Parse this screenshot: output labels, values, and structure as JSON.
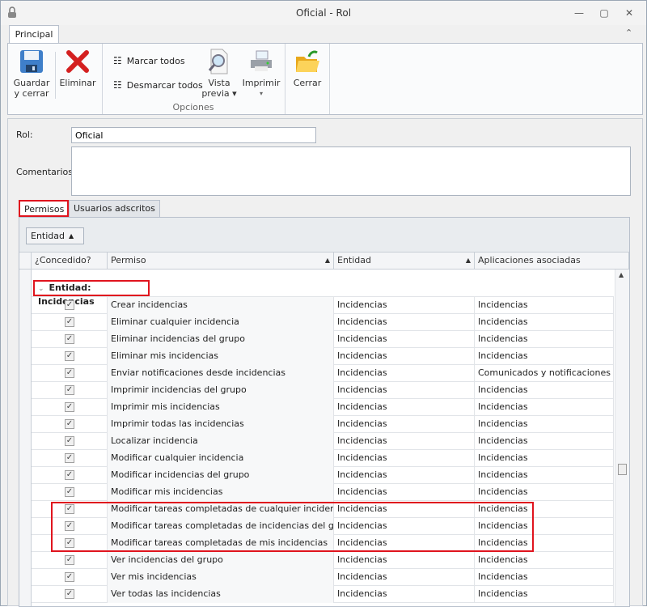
{
  "window": {
    "title": "Oficial - Rol",
    "minimize": "—",
    "maximize": "▢",
    "close": "✕"
  },
  "ribbon": {
    "tab": "Principal",
    "collapse": "⌃",
    "save_l1": "Guardar",
    "save_l2": "y cerrar",
    "delete": "Eliminar",
    "mark_all": "Marcar todos",
    "unmark_all": "Desmarcar todos",
    "preview_l1": "Vista",
    "preview_l2": "previa ▾",
    "print": "Imprimir",
    "print_arrow": "▾",
    "close": "Cerrar",
    "group_options": "Opciones"
  },
  "form": {
    "rol_label": "Rol:",
    "rol_value": "Oficial",
    "comments_label": "Comentarios:",
    "comments_value": ""
  },
  "tabs": [
    "Permisos",
    "Usuarios adscritos"
  ],
  "grid": {
    "group_button": "Entidad",
    "group_arrow": "▲",
    "columns": [
      "¿Concedido?",
      "Permiso",
      "Entidad",
      "Aplicaciones  asociadas"
    ],
    "sort_arrow": "▲",
    "group_row": "Entidad: Incidencias",
    "rows": [
      {
        "checked": true,
        "permiso": "Crear incidencias",
        "entidad": "Incidencias",
        "apps": "Incidencias"
      },
      {
        "checked": true,
        "permiso": "Eliminar cualquier incidencia",
        "entidad": "Incidencias",
        "apps": "Incidencias"
      },
      {
        "checked": true,
        "permiso": "Eliminar incidencias del grupo",
        "entidad": "Incidencias",
        "apps": "Incidencias"
      },
      {
        "checked": true,
        "permiso": "Eliminar mis incidencias",
        "entidad": "Incidencias",
        "apps": "Incidencias"
      },
      {
        "checked": true,
        "permiso": "Enviar notificaciones desde incidencias",
        "entidad": "Incidencias",
        "apps": "Comunicados y notificaciones"
      },
      {
        "checked": true,
        "permiso": "Imprimir incidencias del grupo",
        "entidad": "Incidencias",
        "apps": "Incidencias"
      },
      {
        "checked": true,
        "permiso": "Imprimir mis incidencias",
        "entidad": "Incidencias",
        "apps": "Incidencias"
      },
      {
        "checked": true,
        "permiso": "Imprimir todas las incidencias",
        "entidad": "Incidencias",
        "apps": "Incidencias"
      },
      {
        "checked": true,
        "permiso": "Localizar incidencia",
        "entidad": "Incidencias",
        "apps": "Incidencias"
      },
      {
        "checked": true,
        "permiso": "Modificar cualquier incidencia",
        "entidad": "Incidencias",
        "apps": "Incidencias"
      },
      {
        "checked": true,
        "permiso": "Modificar incidencias del grupo",
        "entidad": "Incidencias",
        "apps": "Incidencias"
      },
      {
        "checked": true,
        "permiso": "Modificar mis incidencias",
        "entidad": "Incidencias",
        "apps": "Incidencias"
      },
      {
        "checked": true,
        "permiso": "Modificar tareas completadas de cualquier incidencia",
        "entidad": "Incidencias",
        "apps": "Incidencias"
      },
      {
        "checked": true,
        "permiso": "Modificar tareas completadas de incidencias del grupo",
        "entidad": "Incidencias",
        "apps": "Incidencias"
      },
      {
        "checked": true,
        "permiso": "Modificar tareas completadas de mis incidencias",
        "entidad": "Incidencias",
        "apps": "Incidencias"
      },
      {
        "checked": true,
        "permiso": "Ver incidencias del grupo",
        "entidad": "Incidencias",
        "apps": "Incidencias"
      },
      {
        "checked": true,
        "permiso": "Ver mis incidencias",
        "entidad": "Incidencias",
        "apps": "Incidencias"
      },
      {
        "checked": true,
        "permiso": "Ver todas las incidencias",
        "entidad": "Incidencias",
        "apps": "Incidencias"
      }
    ]
  },
  "colors": {
    "highlight": "#e0141e"
  }
}
